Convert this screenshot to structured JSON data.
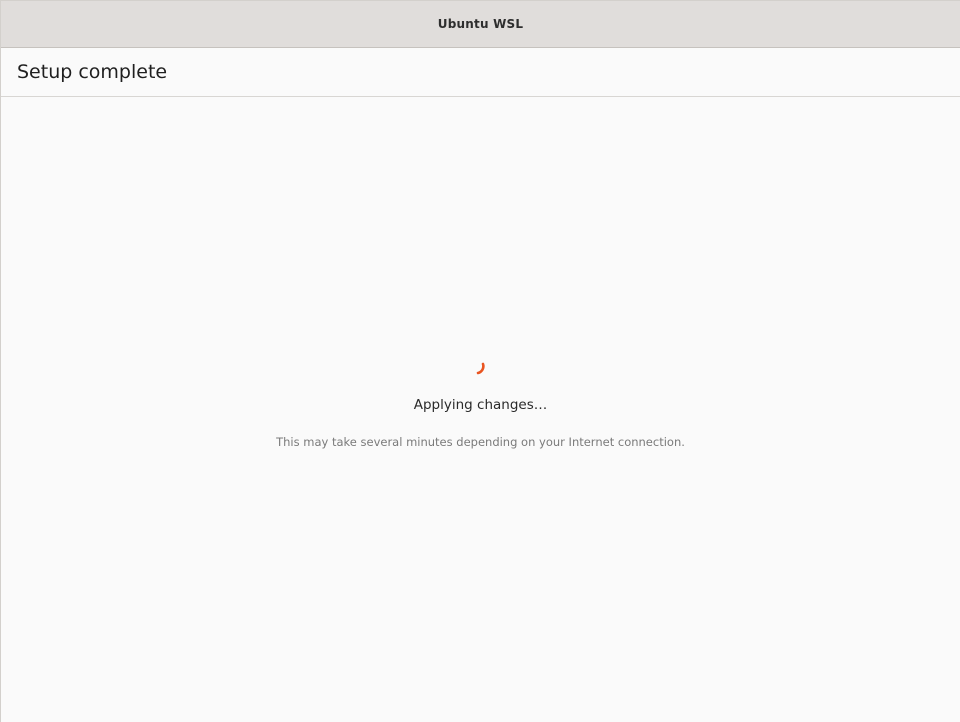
{
  "window": {
    "title": "Ubuntu WSL"
  },
  "header": {
    "title": "Setup complete"
  },
  "status": {
    "title": "Applying changes…",
    "subtitle": "This may take several minutes depending on your Internet connection.",
    "spinner_icon": "spinner-icon",
    "accent_color": "#e95420"
  }
}
